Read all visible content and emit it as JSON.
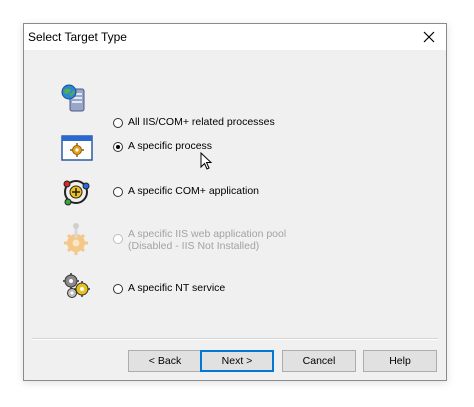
{
  "dialog": {
    "title": "Select Target Type",
    "close_icon": "close-icon"
  },
  "options": [
    {
      "label": "All IIS/COM+ related processes",
      "icon": "server-globe-icon",
      "checked": false,
      "enabled": true
    },
    {
      "label": "A specific process",
      "icon": "window-gear-icon",
      "checked": true,
      "enabled": true
    },
    {
      "label": "A specific COM+ application",
      "icon": "com-plus-icon",
      "checked": false,
      "enabled": true
    },
    {
      "label": "A specific IIS web application pool",
      "sublabel": "(Disabled - IIS Not Installed)",
      "icon": "gear-pin-icon",
      "checked": false,
      "enabled": false
    },
    {
      "label": "A specific NT service",
      "icon": "gears-icon",
      "checked": false,
      "enabled": true
    }
  ],
  "buttons": {
    "back": "< Back",
    "next": "Next >",
    "cancel": "Cancel",
    "help": "Help"
  },
  "colors": {
    "dialog_bg": "#f0f0f0",
    "default_button_border": "#0078d7",
    "disabled_text": "#a3a3a3"
  }
}
